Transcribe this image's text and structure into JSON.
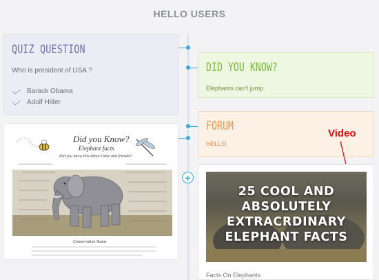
{
  "header": {
    "title": "HELLO USERS"
  },
  "quiz": {
    "title": "QUIZ QUESTION",
    "question": "Who is president of USA ?",
    "options": [
      "Barack Obama",
      "Adolf Hitler"
    ]
  },
  "did_you_know": {
    "title": "DID YOU KNOW?",
    "body": "Elephants can't jump."
  },
  "forum": {
    "title": "FORUM",
    "body": "HELLO"
  },
  "annotation": {
    "label": "Video"
  },
  "infographic": {
    "heading": "Did you Know?",
    "subheading": "Elephant facts",
    "tagline": "Did you know this about Ozzie and friends?",
    "footer_title": "Conservation Status"
  },
  "video": {
    "title_lines": [
      "25 COOL AND",
      "ABSOLUTELY",
      "EXTRACRDINARY",
      "ELEPHANT FACTS"
    ],
    "caption": "Facts On Elephants"
  },
  "colors": {
    "accent": "#3aa7e0",
    "quiz": "#6a72a8",
    "did_you_know": "#7bb83c",
    "forum": "#e79a4f",
    "annotation": "#e01010"
  }
}
